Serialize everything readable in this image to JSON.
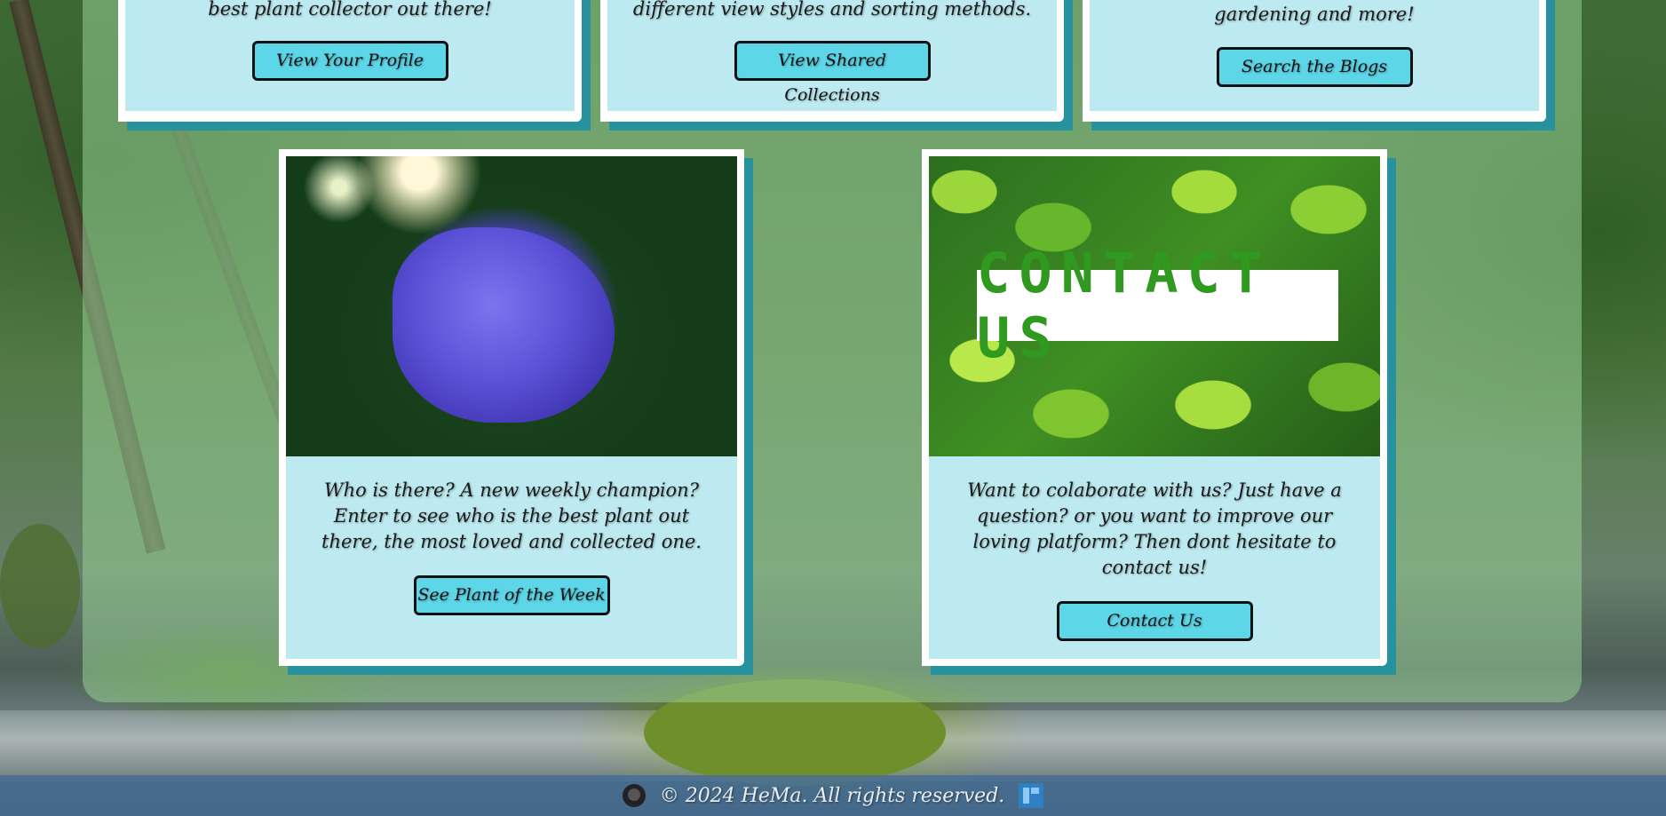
{
  "top_cards": [
    {
      "caption": "best plant collector out there!",
      "button": "View Your Profile"
    },
    {
      "caption": "different view styles and sorting methods.",
      "button": "View Shared Collections"
    },
    {
      "caption": "gardening and more!",
      "button": "Search the Blogs"
    }
  ],
  "feature_cards": [
    {
      "image_alt": "blue hydrangea flower",
      "caption": "Who is there? A new weekly champion? Enter to see who is the best plant out there, the most loved and collected one.",
      "button": "See Plant of the Week"
    },
    {
      "image_alt": "green leaves",
      "image_text": "CONTACT US",
      "caption": "Want to colaborate with us? Just have a question? or you want to improve our loving platform? Then dont hesitate to contact us!",
      "button": "Contact Us"
    }
  ],
  "footer": {
    "copyright": "© 2024 HeMa. All rights reserved.",
    "icons": [
      "github-icon",
      "figma-icon"
    ]
  },
  "colors": {
    "button_bg": "#5dd6e8",
    "card_bg": "#bdeaf0",
    "card_shadow": "#27919e",
    "footer_bg": "#466e96"
  }
}
